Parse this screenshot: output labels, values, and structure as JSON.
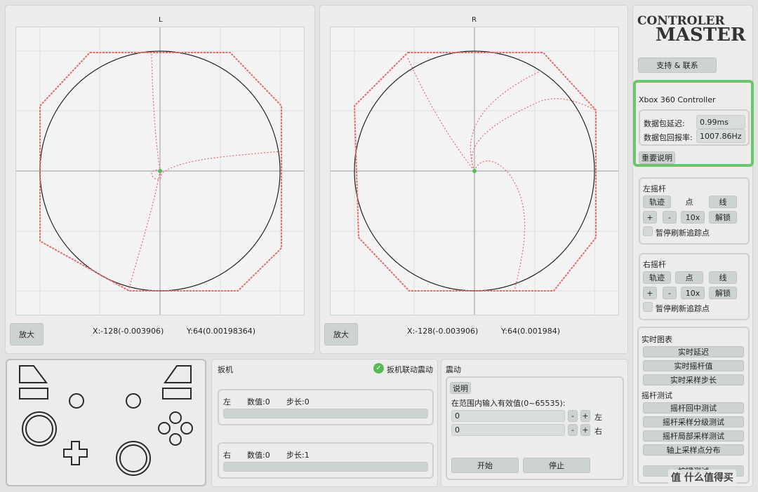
{
  "left_stick": {
    "title": "L",
    "zoom_label": "放大",
    "x_readout": "X:-128(-0.003906)",
    "y_readout": "Y:64(0.00198364)"
  },
  "right_stick": {
    "title": "R",
    "zoom_label": "放大",
    "x_readout": "X:-128(-0.003906)",
    "y_readout": "Y:64(0.001984)"
  },
  "sidebar": {
    "logo_line1": "CONTROLER",
    "logo_line2": "MASTER",
    "support_label": "支持 & 联系",
    "device": {
      "name": "Xbox 360 Controller",
      "latency_label": "数据包延迟:",
      "latency_value": "0.99ms",
      "rate_label": "数据包回报率:",
      "rate_value": "1007.86Hz",
      "note_label": "重要说明"
    },
    "left_stick_group": {
      "title": "左摇杆",
      "trace": "轨迹",
      "point": "点",
      "line": "线",
      "plus": "+",
      "minus": "-",
      "scale": "10x",
      "unlock": "解锁",
      "pause_label": "暂停刷新追踪点"
    },
    "right_stick_group": {
      "title": "右摇杆",
      "trace": "轨迹",
      "point": "点",
      "line": "线",
      "plus": "+",
      "minus": "-",
      "scale": "10x",
      "unlock": "解锁",
      "pause_label": "暂停刷新追踪点"
    },
    "realtime": {
      "title": "实时图表",
      "latency": "实时延迟",
      "stick_value": "实时摇杆值",
      "sample_step": "实时采样步长"
    },
    "stick_test": {
      "title": "摇杆测试",
      "center": "摇杆回中测试",
      "grade": "摇杆采样分级测试",
      "local": "摇杆局部采样测试",
      "axis": "轴上采样点分布",
      "key": "按键测试"
    }
  },
  "trigger": {
    "title": "扳机",
    "link_label": "扳机联动震动",
    "left": {
      "name": "左",
      "value_label": "数值:0",
      "step_label": "步长:0"
    },
    "right": {
      "name": "右",
      "value_label": "数值:0",
      "step_label": "步长:1"
    }
  },
  "vibration": {
    "title": "震动",
    "help_label": "说明",
    "range_label": "在范围内输入有效值(0~65535):",
    "left_value": "0",
    "right_value": "0",
    "minus": "-",
    "plus": "+",
    "left_side": "左",
    "right_side": "右",
    "start": "开始",
    "stop": "停止"
  },
  "watermark": "值 什么值得买",
  "colors": {
    "trace": "#e56a6a",
    "circle": "#222222",
    "highlight_border": "#6cc46c",
    "check": "#5ab85a"
  }
}
